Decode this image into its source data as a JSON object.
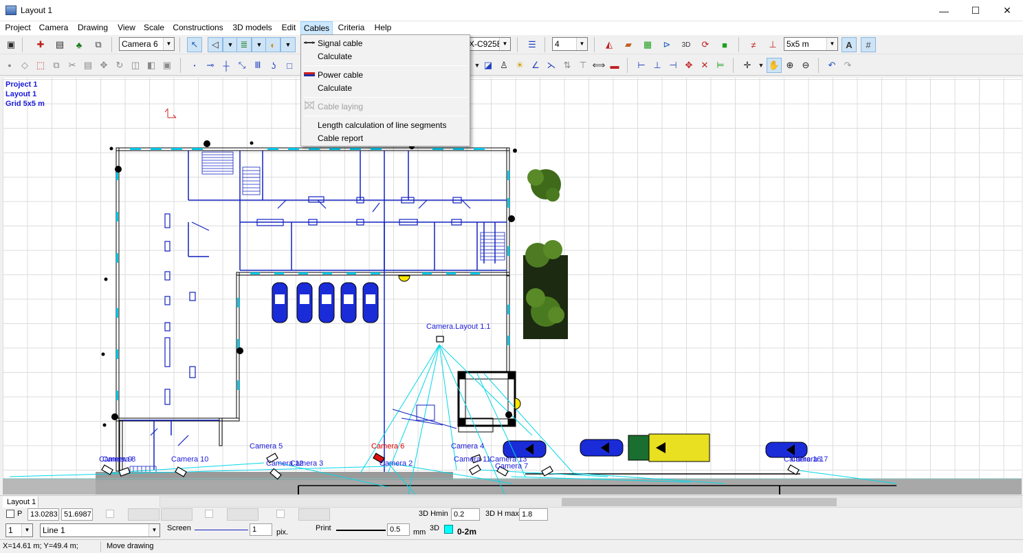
{
  "window": {
    "title": "Layout 1",
    "minimize_glyph": "—",
    "maximize_glyph": "☐",
    "close_glyph": "✕"
  },
  "menu": [
    "Project",
    "Camera",
    "Drawing",
    "View",
    "Scale",
    "Constructions",
    "3D models",
    "Edit",
    "Cables",
    "Criteria",
    "Help"
  ],
  "active_menu": "Cables",
  "toolbar": {
    "camera_select": "Camera 6",
    "model_select": "X-C925E",
    "number_select": "4",
    "grid_select": "5x5 m"
  },
  "cables_menu": {
    "signal_cable": "Signal cable",
    "signal_calculate": "Calculate",
    "power_cable": "Power cable",
    "power_calculate": "Calculate",
    "cable_laying": "Cable laying",
    "length_calc": "Length calculation of line segments",
    "cable_report": "Cable report"
  },
  "canvas_info": {
    "project": "Project 1",
    "layout": "Layout 1",
    "grid": "Grid 5x5 m"
  },
  "cameras": [
    {
      "name": "Camera.Layout 1.1"
    },
    {
      "name": "Camera 5"
    },
    {
      "name": "Camera 6"
    },
    {
      "name": "Camera 4"
    },
    {
      "name": "Camera 9"
    },
    {
      "name": "Camera 8"
    },
    {
      "name": "Camera 10"
    },
    {
      "name": "Camera 12"
    },
    {
      "name": "Camera 3"
    },
    {
      "name": "Camera 2"
    },
    {
      "name": "Camera 11"
    },
    {
      "name": "Camera 13"
    },
    {
      "name": "Camera 7"
    },
    {
      "name": "Camera 16"
    },
    {
      "name": "Camera 17"
    }
  ],
  "tabs": {
    "active": "Layout 1"
  },
  "status": {
    "p_label": "P",
    "p_x": "13.0283",
    "p_y": "51.6987",
    "hmin_label": "3D Hmin",
    "hmin_value": "0.2",
    "hmax_label": "3D H max",
    "hmax_value": "1.8",
    "line_num": "1",
    "line_type": "Line 1",
    "screen_label": "Screen",
    "screen_value": "1",
    "screen_unit": "pix.",
    "print_label": "Print",
    "print_value": "0.5",
    "print_unit": "mm",
    "label_3d": "3D",
    "range_3d": "0-2m",
    "range_color": "#00ffff",
    "coords": "X=14.61 m; Y=49.4 m;",
    "mode": "Move drawing"
  }
}
